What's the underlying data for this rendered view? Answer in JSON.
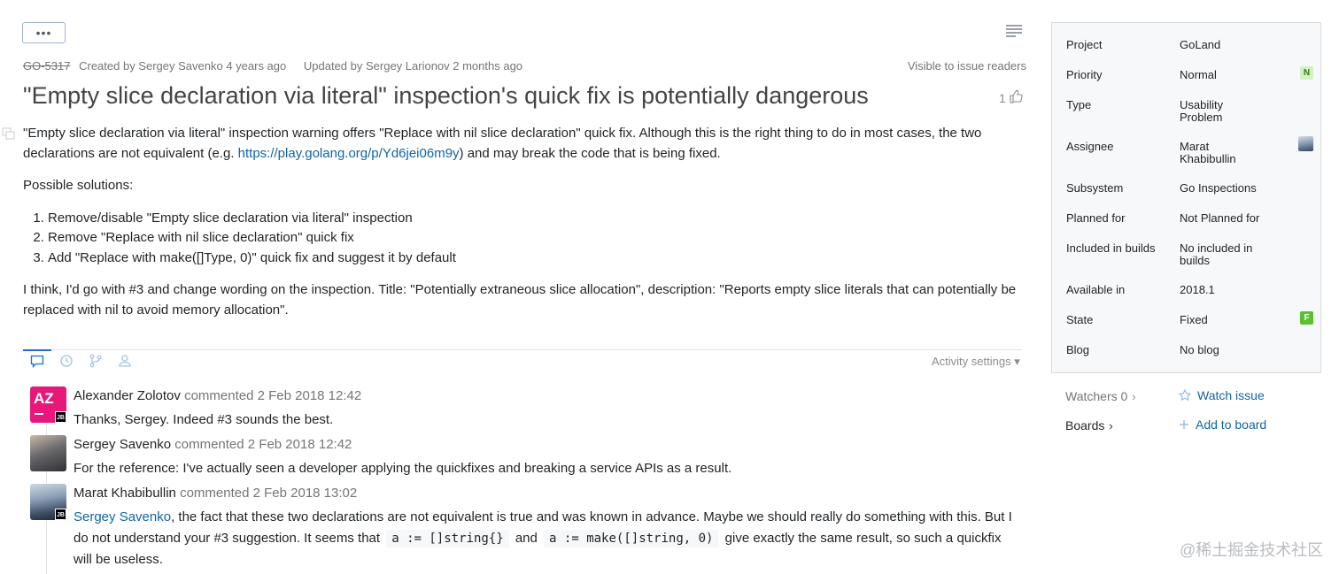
{
  "toolbar": {
    "more_label": "•••"
  },
  "issue": {
    "id": "GO-5317",
    "created": "Created by Sergey Savenko 4 years ago",
    "updated": "Updated by Sergey Larionov 2 months ago",
    "visibility": "Visible to issue readers",
    "title": "\"Empty slice declaration via literal\" inspection's quick fix is potentially dangerous",
    "likes": "1"
  },
  "description": {
    "p1_a": "\"Empty slice declaration via literal\" inspection warning offers \"Replace with nil slice declaration\" quick fix. Although this is the right thing to do in most cases, the two declarations are not equivalent (e.g. ",
    "p1_link": "https://play.golang.org/p/Yd6jei06m9y",
    "p1_b": ") and may break the code that is being fixed.",
    "p2": "Possible solutions:",
    "solutions": [
      "Remove/disable \"Empty slice declaration via literal\" inspection",
      "Remove \"Replace with nil slice declaration\" quick fix",
      "Add \"Replace with make([]Type, 0)\" quick fix and suggest it by default"
    ],
    "p3": "I think, I'd go with #3 and change wording on the inspection. Title: \"Potentially extraneous slice allocation\", description: \"Reports empty slice literals that can potentially be replaced with nil to avoid memory allocation\"."
  },
  "activity": {
    "settings_label": "Activity settings ▾"
  },
  "comments": [
    {
      "initials": "AZ",
      "author": "Alexander Zolotov",
      "when": "commented 2 Feb 2018 12:42",
      "body": "Thanks, Sergey. Indeed #3 sounds the best.",
      "badge": "JB"
    },
    {
      "author": "Sergey Savenko",
      "when": "commented 2 Feb 2018 12:42",
      "body": "For the reference: I've actually seen a developer applying the quickfixes and breaking a service APIs as a result."
    },
    {
      "author": "Marat Khabibullin",
      "when": "commented 2 Feb 2018 13:02",
      "badge": "JB",
      "mention": "Sergey Savenko",
      "body_a": ", the fact that these two declarations are not equivalent is true and was known in advance. Maybe we should really do something with this. But I do not understand your #3 suggestion. It seems that",
      "code1": "a := []string{}",
      "body_b": "and",
      "code2": "a := make([]string, 0)",
      "body_c": "give exactly the same result, so such a quickfix will be useless."
    }
  ],
  "sidebar": {
    "fields": [
      {
        "label": "Project",
        "value": "GoLand"
      },
      {
        "label": "Priority",
        "value": "Normal",
        "badge": "N"
      },
      {
        "label": "Type",
        "value": "Usability Problem"
      },
      {
        "label": "Assignee",
        "value": "Marat Khabibullin"
      },
      {
        "label": "Subsystem",
        "value": "Go Inspections"
      },
      {
        "label": "Planned for",
        "value": "Not Planned for"
      },
      {
        "label": "Included in builds",
        "value": "No included in builds"
      },
      {
        "label": "Available in",
        "value": "2018.1"
      },
      {
        "label": "State",
        "value": "Fixed",
        "badge": "F"
      },
      {
        "label": "Blog",
        "value": "No blog"
      }
    ],
    "watchers_label": "Watchers 0",
    "boards_label": "Boards",
    "watch_issue_label": "Watch issue",
    "add_to_board_label": "Add to board"
  },
  "watermark": "@稀土掘金技术社区",
  "colors": {
    "link": "#1264a3",
    "accent": "#1d6bd8",
    "fixed_badge": "#5bbf30",
    "az_avatar": "#e6197b"
  }
}
